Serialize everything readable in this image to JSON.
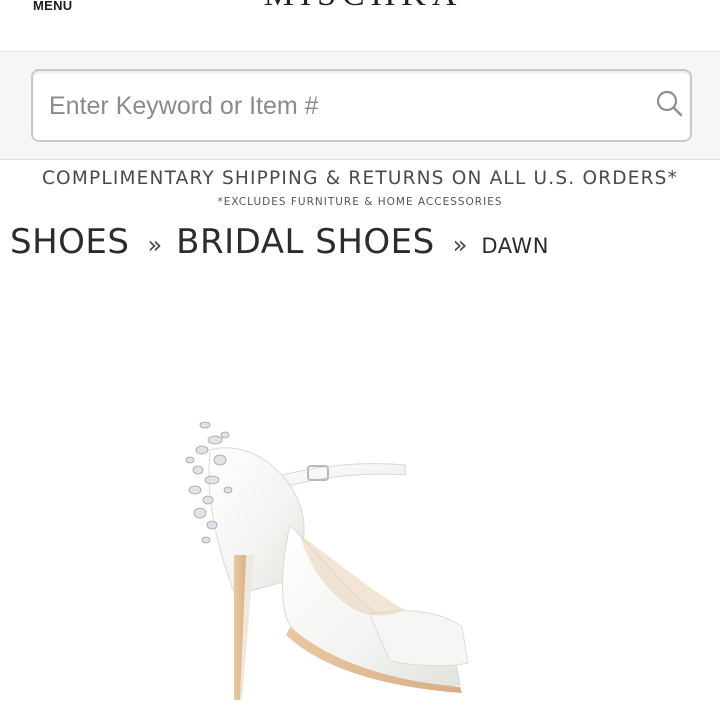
{
  "header": {
    "menu_label": "MENU",
    "brand": "MISCHKA"
  },
  "search": {
    "placeholder": "Enter Keyword or Item #",
    "value": "",
    "icon": "search-icon"
  },
  "promo": {
    "main": "COMPLIMENTARY SHIPPING & RETURNS ON ALL U.S. ORDERS*",
    "sub": "*EXCLUDES FURNITURE & HOME ACCESSORIES"
  },
  "breadcrumb": {
    "items": [
      "SHOES",
      "BRIDAL SHOES",
      "DAWN"
    ],
    "separator": "»"
  },
  "product": {
    "image": "white satin peep-toe ankle-strap stiletto with crystal embellished heel"
  },
  "colors": {
    "background": "#ffffff",
    "band": "#f5f6f8",
    "text": "#333333"
  }
}
